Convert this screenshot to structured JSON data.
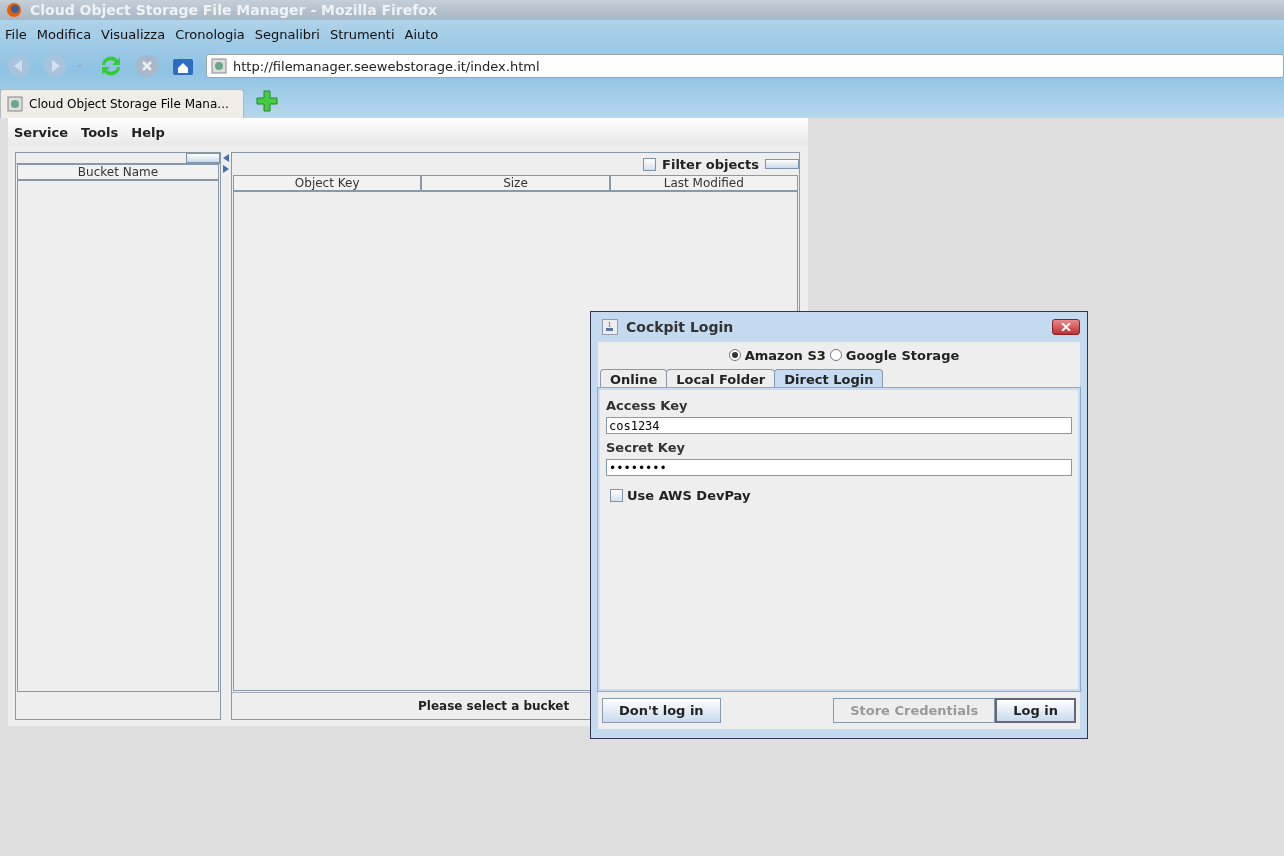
{
  "window": {
    "title": "Cloud Object Storage File Manager - Mozilla Firefox"
  },
  "browser_menu": [
    {
      "label": "File"
    },
    {
      "label": "Modifica"
    },
    {
      "label": "Visualizza"
    },
    {
      "label": "Cronologia"
    },
    {
      "label": "Segnalibri"
    },
    {
      "label": "Strumenti"
    },
    {
      "label": "Aiuto"
    }
  ],
  "address_bar": {
    "value": "http://filemanager.seewebstorage.it/index.html"
  },
  "browser_tabs": [
    {
      "label": "Cloud Object Storage File Mana...",
      "selected": true
    }
  ],
  "app_menu": [
    "Service",
    "Tools",
    "Help"
  ],
  "buckets_table": {
    "columns": [
      "Bucket Name"
    ]
  },
  "objects_panel": {
    "filter_label": "Filter objects",
    "filter_checked": false,
    "columns": [
      "Object Key",
      "Size",
      "Last Modified"
    ],
    "status": "Please select a bucket"
  },
  "dialog": {
    "title": "Cockpit Login",
    "providers": [
      {
        "label": "Amazon S3",
        "selected": true
      },
      {
        "label": "Google Storage",
        "selected": false
      }
    ],
    "tabs": [
      {
        "label": "Online",
        "selected": false
      },
      {
        "label": "Local Folder",
        "selected": false
      },
      {
        "label": "Direct Login",
        "selected": true
      }
    ],
    "fields": [
      {
        "label": "Access Key",
        "value": "cos1234"
      },
      {
        "label": "Secret Key",
        "value": "••••••••"
      }
    ],
    "devpay": {
      "label": "Use AWS DevPay",
      "checked": false
    },
    "buttons": [
      {
        "label": "Don't log in",
        "disabled": false,
        "default": false
      },
      {
        "label": "Store Credentials",
        "disabled": true,
        "default": false
      },
      {
        "label": "Log in",
        "disabled": false,
        "default": true
      }
    ]
  }
}
